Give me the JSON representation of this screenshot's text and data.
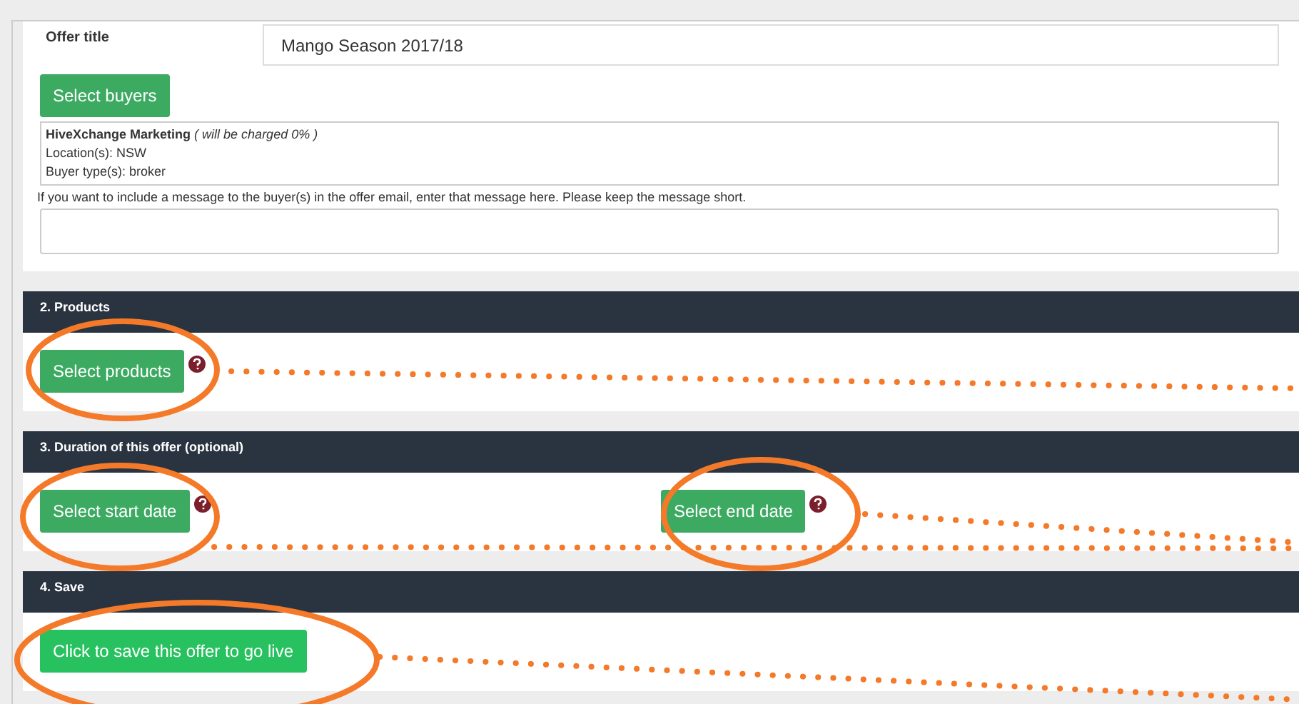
{
  "offer_title": {
    "label": "Offer title",
    "value": "Mango Season 2017/18"
  },
  "buyers": {
    "button": "Select buyers",
    "lines": [
      "**HiveXchange Marketing** *( will be charged 0% )*",
      "Location(s): NSW",
      "Buyer type(s): broker"
    ]
  },
  "message": {
    "label": "If you want to include a message to the buyer(s) in the offer email, enter that message here. Please keep the message short."
  },
  "sections": [
    {
      "title": "2. Products",
      "buttons": [
        {
          "label": "Select products",
          "kind": "select",
          "help": true
        }
      ]
    },
    {
      "title": "3. Duration of this offer (optional)",
      "buttons": [
        {
          "label": "Select start date",
          "kind": "select",
          "help": true
        },
        {
          "label": "Select end date",
          "kind": "select",
          "help": true
        }
      ]
    },
    {
      "title": "4. Save",
      "buttons": [
        {
          "label": "Click to save this offer to go live",
          "kind": "save",
          "help": false
        }
      ]
    }
  ]
}
